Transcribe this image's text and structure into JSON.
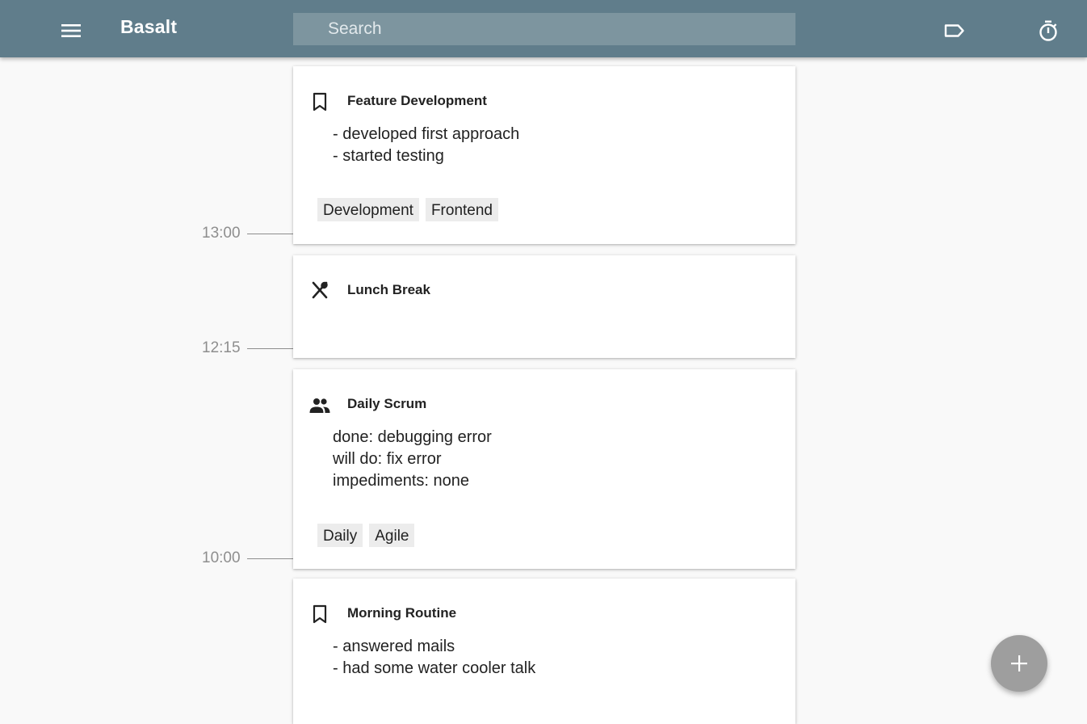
{
  "app": {
    "title": "Basalt",
    "search_placeholder": "Search"
  },
  "colors": {
    "appbar": "#607d8b",
    "search_bg": "#7d959f",
    "background": "#f9f9f9",
    "tag_bg": "#ececec",
    "fab": "#9e9e9e",
    "time_label": "#8e8e8e"
  },
  "toolbar": {
    "menu_icon": "menu-icon",
    "label_icon": "label-outline-icon",
    "timer_icon": "timer-icon"
  },
  "timeline": [
    {
      "time": "13:00"
    },
    {
      "time": "12:15"
    },
    {
      "time": "10:00"
    }
  ],
  "entries": [
    {
      "icon": "bookmark-icon",
      "title": "Feature Development",
      "description": "- developed first approach\n- started testing",
      "tags": [
        "Development",
        "Frontend"
      ]
    },
    {
      "icon": "food-icon",
      "title": "Lunch Break",
      "description": "",
      "tags": []
    },
    {
      "icon": "group-icon",
      "title": "Daily Scrum",
      "description": "done: debugging error\nwill do: fix error\nimpediments: none",
      "tags": [
        "Daily",
        "Agile"
      ]
    },
    {
      "icon": "bookmark-icon",
      "title": "Morning Routine",
      "description": "- answered mails\n- had some water cooler talk",
      "tags": []
    }
  ],
  "fab": {
    "icon": "add-icon"
  }
}
